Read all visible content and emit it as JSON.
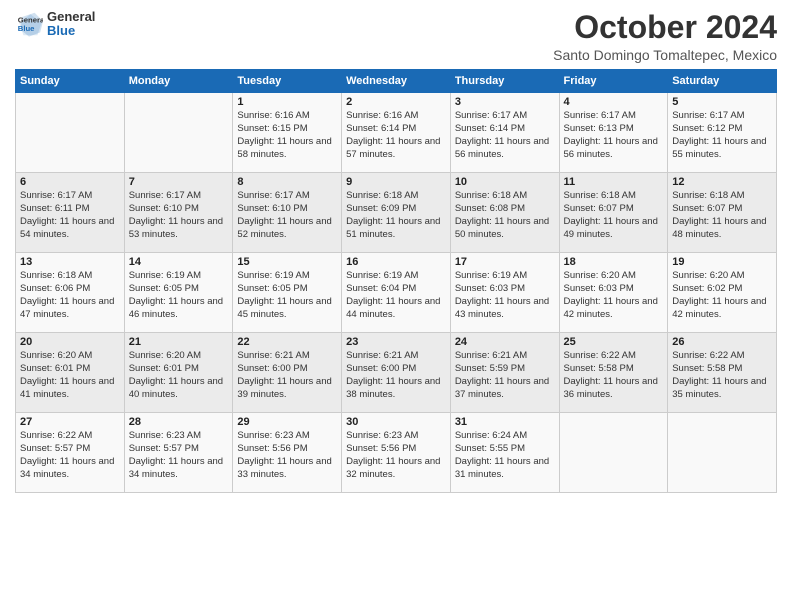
{
  "logo": {
    "line1": "General",
    "line2": "Blue"
  },
  "title": "October 2024",
  "subtitle": "Santo Domingo Tomaltepec, Mexico",
  "days_header": [
    "Sunday",
    "Monday",
    "Tuesday",
    "Wednesday",
    "Thursday",
    "Friday",
    "Saturday"
  ],
  "weeks": [
    [
      {
        "num": "",
        "info": ""
      },
      {
        "num": "",
        "info": ""
      },
      {
        "num": "1",
        "info": "Sunrise: 6:16 AM\nSunset: 6:15 PM\nDaylight: 11 hours\nand 58 minutes."
      },
      {
        "num": "2",
        "info": "Sunrise: 6:16 AM\nSunset: 6:14 PM\nDaylight: 11 hours\nand 57 minutes."
      },
      {
        "num": "3",
        "info": "Sunrise: 6:17 AM\nSunset: 6:14 PM\nDaylight: 11 hours\nand 56 minutes."
      },
      {
        "num": "4",
        "info": "Sunrise: 6:17 AM\nSunset: 6:13 PM\nDaylight: 11 hours\nand 56 minutes."
      },
      {
        "num": "5",
        "info": "Sunrise: 6:17 AM\nSunset: 6:12 PM\nDaylight: 11 hours\nand 55 minutes."
      }
    ],
    [
      {
        "num": "6",
        "info": "Sunrise: 6:17 AM\nSunset: 6:11 PM\nDaylight: 11 hours\nand 54 minutes."
      },
      {
        "num": "7",
        "info": "Sunrise: 6:17 AM\nSunset: 6:10 PM\nDaylight: 11 hours\nand 53 minutes."
      },
      {
        "num": "8",
        "info": "Sunrise: 6:17 AM\nSunset: 6:10 PM\nDaylight: 11 hours\nand 52 minutes."
      },
      {
        "num": "9",
        "info": "Sunrise: 6:18 AM\nSunset: 6:09 PM\nDaylight: 11 hours\nand 51 minutes."
      },
      {
        "num": "10",
        "info": "Sunrise: 6:18 AM\nSunset: 6:08 PM\nDaylight: 11 hours\nand 50 minutes."
      },
      {
        "num": "11",
        "info": "Sunrise: 6:18 AM\nSunset: 6:07 PM\nDaylight: 11 hours\nand 49 minutes."
      },
      {
        "num": "12",
        "info": "Sunrise: 6:18 AM\nSunset: 6:07 PM\nDaylight: 11 hours\nand 48 minutes."
      }
    ],
    [
      {
        "num": "13",
        "info": "Sunrise: 6:18 AM\nSunset: 6:06 PM\nDaylight: 11 hours\nand 47 minutes."
      },
      {
        "num": "14",
        "info": "Sunrise: 6:19 AM\nSunset: 6:05 PM\nDaylight: 11 hours\nand 46 minutes."
      },
      {
        "num": "15",
        "info": "Sunrise: 6:19 AM\nSunset: 6:05 PM\nDaylight: 11 hours\nand 45 minutes."
      },
      {
        "num": "16",
        "info": "Sunrise: 6:19 AM\nSunset: 6:04 PM\nDaylight: 11 hours\nand 44 minutes."
      },
      {
        "num": "17",
        "info": "Sunrise: 6:19 AM\nSunset: 6:03 PM\nDaylight: 11 hours\nand 43 minutes."
      },
      {
        "num": "18",
        "info": "Sunrise: 6:20 AM\nSunset: 6:03 PM\nDaylight: 11 hours\nand 42 minutes."
      },
      {
        "num": "19",
        "info": "Sunrise: 6:20 AM\nSunset: 6:02 PM\nDaylight: 11 hours\nand 42 minutes."
      }
    ],
    [
      {
        "num": "20",
        "info": "Sunrise: 6:20 AM\nSunset: 6:01 PM\nDaylight: 11 hours\nand 41 minutes."
      },
      {
        "num": "21",
        "info": "Sunrise: 6:20 AM\nSunset: 6:01 PM\nDaylight: 11 hours\nand 40 minutes."
      },
      {
        "num": "22",
        "info": "Sunrise: 6:21 AM\nSunset: 6:00 PM\nDaylight: 11 hours\nand 39 minutes."
      },
      {
        "num": "23",
        "info": "Sunrise: 6:21 AM\nSunset: 6:00 PM\nDaylight: 11 hours\nand 38 minutes."
      },
      {
        "num": "24",
        "info": "Sunrise: 6:21 AM\nSunset: 5:59 PM\nDaylight: 11 hours\nand 37 minutes."
      },
      {
        "num": "25",
        "info": "Sunrise: 6:22 AM\nSunset: 5:58 PM\nDaylight: 11 hours\nand 36 minutes."
      },
      {
        "num": "26",
        "info": "Sunrise: 6:22 AM\nSunset: 5:58 PM\nDaylight: 11 hours\nand 35 minutes."
      }
    ],
    [
      {
        "num": "27",
        "info": "Sunrise: 6:22 AM\nSunset: 5:57 PM\nDaylight: 11 hours\nand 34 minutes."
      },
      {
        "num": "28",
        "info": "Sunrise: 6:23 AM\nSunset: 5:57 PM\nDaylight: 11 hours\nand 34 minutes."
      },
      {
        "num": "29",
        "info": "Sunrise: 6:23 AM\nSunset: 5:56 PM\nDaylight: 11 hours\nand 33 minutes."
      },
      {
        "num": "30",
        "info": "Sunrise: 6:23 AM\nSunset: 5:56 PM\nDaylight: 11 hours\nand 32 minutes."
      },
      {
        "num": "31",
        "info": "Sunrise: 6:24 AM\nSunset: 5:55 PM\nDaylight: 11 hours\nand 31 minutes."
      },
      {
        "num": "",
        "info": ""
      },
      {
        "num": "",
        "info": ""
      }
    ]
  ]
}
